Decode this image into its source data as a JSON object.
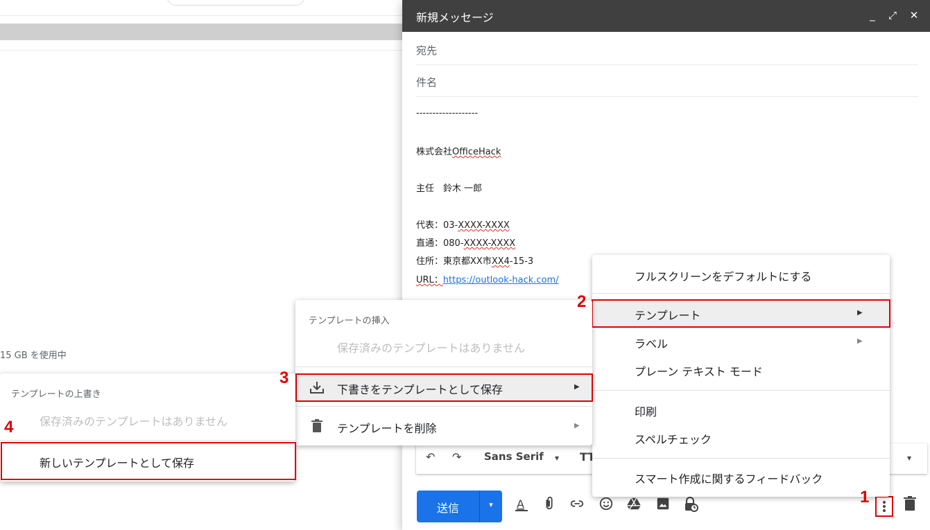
{
  "background": {
    "storage_text": "15 GB を使用中"
  },
  "compose": {
    "title": "新規メッセージ",
    "controls": {
      "minimize": "_",
      "expand": "⤢",
      "close": "✕"
    },
    "to_placeholder": "宛先",
    "subject_placeholder": "件名",
    "body": {
      "separator": "-------------------",
      "company_prefix": "株式会社",
      "company_name": "OfficeHack",
      "title_name": "主任　鈴木 一郎",
      "phone_main_label": "代表：03-",
      "phone_main_value": "XXXX-XXXX",
      "phone_direct_label": "直通：080-",
      "phone_direct_value": "XXXX-XXXX",
      "address_label": "住所：東京都XX市",
      "address_mid": "XX4",
      "address_tail": "-15-3",
      "url_label": "URL：",
      "url_value": "https://outlook-hack.com/"
    },
    "format_toolbar": {
      "undo": "↶",
      "redo": "↷",
      "font": "Sans Serif",
      "font_caret": "▾",
      "size_icon": "TT",
      "more_caret": "▾"
    },
    "send_label": "送信",
    "send_caret": "▾"
  },
  "menus": {
    "more_options": [
      {
        "label": "フルスクリーンをデフォルトにする"
      },
      {
        "label": "テンプレート",
        "submenu": true
      },
      {
        "label": "ラベル",
        "submenu": true
      },
      {
        "label": "プレーン テキスト モード"
      },
      {
        "label": "印刷"
      },
      {
        "label": "スペルチェック"
      },
      {
        "label": "スマート作成に関するフィードバック"
      }
    ],
    "templates": {
      "insert_heading": "テンプレートの挿入",
      "none_saved": "保存済みのテンプレートはありません",
      "save_draft": "下書きをテンプレートとして保存",
      "delete": "テンプレートを削除"
    },
    "overwrite": {
      "heading": "テンプレートの上書き",
      "none_saved": "保存済みのテンプレートはありません",
      "new_template": "新しいテンプレートとして保存"
    }
  },
  "steps": {
    "s1": "1",
    "s2": "2",
    "s3": "3",
    "s4": "4"
  },
  "colors": {
    "header": "#404040",
    "send": "#1a73e8",
    "highlight": "#e00000"
  }
}
